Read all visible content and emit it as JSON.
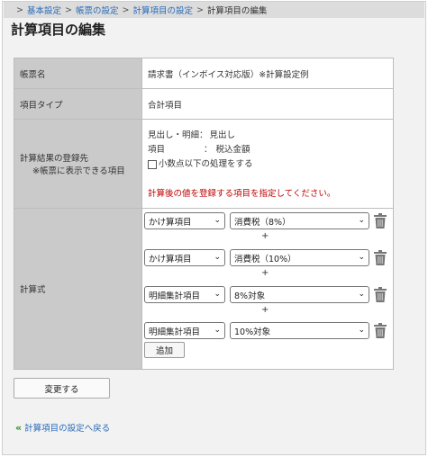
{
  "breadcrumb": {
    "items": [
      "基本設定",
      "帳票の設定",
      "計算項目の設定"
    ],
    "current": "計算項目の編集",
    "separator": ">"
  },
  "page_title": "計算項目の編集",
  "form": {
    "form_name_label": "帳票名",
    "form_name_value": "請求書（インボイス対応版）※計算設定例",
    "item_type_label": "項目タイプ",
    "item_type_value": "合計項目",
    "dest_label": "計算結果の登録先",
    "dest_sublabel": "※帳票に表示できる項目",
    "dest_heading_key": "見出し・明細：",
    "dest_heading_value": "見出し",
    "dest_item_key": "項目",
    "dest_item_colon": "：",
    "dest_item_value": "税込金額",
    "decimal_checkbox_label": "小数点以下の処理をする",
    "decimal_checked": false,
    "notice": "計算後の値を登録する項目を指定してください。",
    "formula_label": "計算式",
    "formula_rows": [
      {
        "type": "かけ算項目",
        "target": "消費税（8%）"
      },
      {
        "type": "かけ算項目",
        "target": "消費税（10%）"
      },
      {
        "type": "明細集計項目",
        "target": "8%対象"
      },
      {
        "type": "明細集計項目",
        "target": "10%対象"
      }
    ],
    "operator": "+",
    "add_button": "追加"
  },
  "submit_button": "変更する",
  "back_link": "計算項目の設定へ戻る",
  "icons": {
    "delete": "trash-icon",
    "back": "double-chevron-left-icon",
    "select": "chevron-down-icon"
  },
  "colors": {
    "link": "#2a6bb8",
    "notice": "#c00000",
    "label_bg": "#c9cac9",
    "back_icon": "#2d8a2d"
  }
}
